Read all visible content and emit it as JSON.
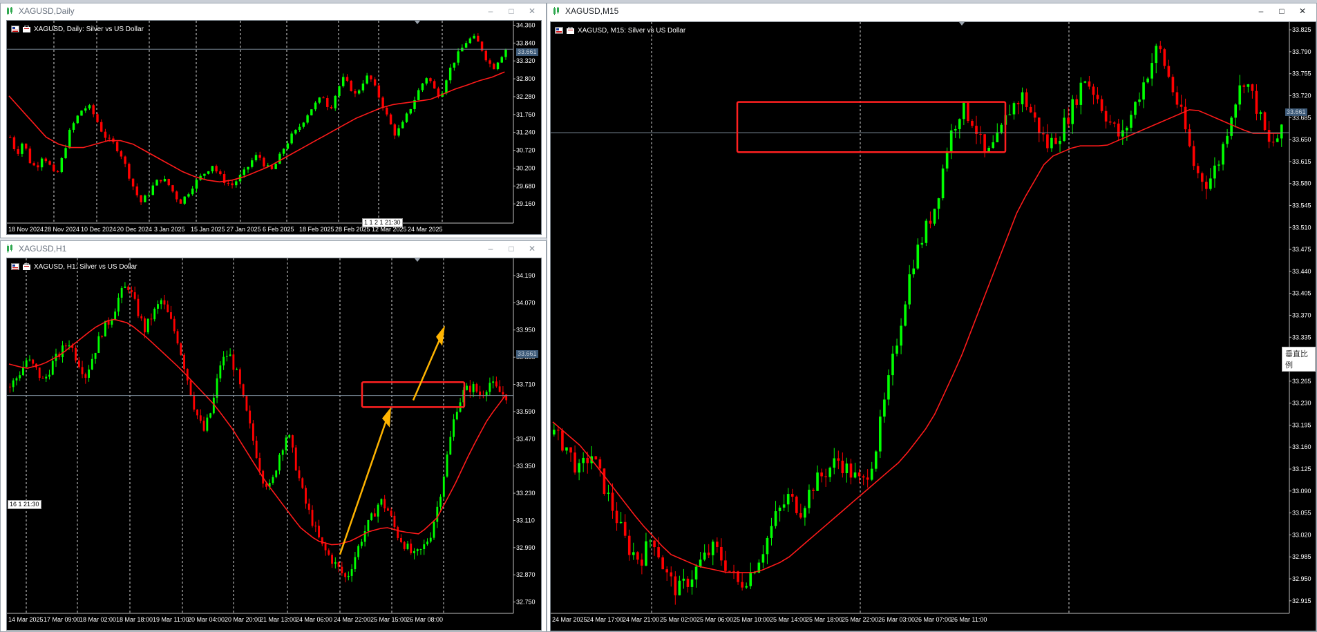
{
  "colors": {
    "bull": "#00ff00",
    "bear": "#ff0000",
    "ma": "#ff1a1a",
    "grid": "#ffffff",
    "bid_line": "#7c8b99",
    "box": "#ff2020",
    "arrow": "#ffb400",
    "axis_text": "#ffffff"
  },
  "windows": [
    {
      "id": "daily",
      "title": "XAGUSD,Daily",
      "chart_label": "XAGUSD, Daily:  Silver vs US Dollar",
      "price_tag": "33.661",
      "mini_tag": "1 1 2 1 21:30",
      "controls": {
        "minimize": "–",
        "maximize": "□",
        "close": "✕"
      }
    },
    {
      "id": "h1",
      "title": "XAGUSD,H1",
      "chart_label": "XAGUSD, H1:  Silver vs US Dollar",
      "price_tag": "33.661",
      "mini_tag": "16 1 21:30",
      "controls": {
        "minimize": "–",
        "maximize": "□",
        "close": "✕"
      }
    },
    {
      "id": "m15",
      "title": "XAGUSD,M15",
      "chart_label": "XAGUSD, M15:  Silver vs US Dollar",
      "price_tag": "33.661",
      "tooltip": "垂直比例",
      "controls": {
        "minimize": "–",
        "maximize": "□",
        "close": "✕"
      }
    }
  ],
  "chart_data": [
    {
      "type": "candlestick",
      "title": "XAGUSD, Daily:  Silver vs US Dollar",
      "x_tick_labels": [
        "18 Nov 2024",
        "28 Nov 2024",
        "10 Dec 2024",
        "20 Dec 2024",
        "3 Jan 2025",
        "15 Jan 2025",
        "27 Jan 2025",
        "6 Feb 2025",
        "18 Feb 2025",
        "28 Feb 2025",
        "12 Mar 2025",
        "24 Mar 2025"
      ],
      "y_tick_labels": [
        "34.360",
        "33.840",
        "33.320",
        "32.800",
        "32.280",
        "31.760",
        "31.240",
        "30.720",
        "30.200",
        "29.680",
        "29.160"
      ],
      "ylim": [
        28.6,
        34.45
      ],
      "current_price": 33.661,
      "close_path": [
        31.1,
        30.6,
        31.0,
        30.4,
        30.2,
        30.6,
        30.3,
        29.9,
        30.5,
        31.2,
        31.6,
        31.9,
        32.0,
        31.7,
        31.3,
        31.0,
        30.9,
        30.6,
        30.1,
        29.6,
        29.2,
        29.4,
        29.7,
        29.9,
        29.8,
        29.5,
        29.2,
        29.4,
        29.7,
        29.9,
        30.1,
        30.3,
        30.0,
        29.8,
        29.7,
        29.9,
        30.1,
        30.4,
        30.6,
        30.3,
        30.1,
        30.4,
        30.8,
        31.1,
        31.3,
        31.6,
        31.9,
        32.1,
        32.3,
        31.9,
        32.4,
        32.8,
        32.6,
        32.3,
        32.7,
        32.9,
        32.5,
        32.1,
        31.6,
        31.2,
        31.4,
        31.8,
        32.2,
        32.6,
        32.9,
        32.5,
        32.3,
        32.9,
        33.3,
        33.6,
        33.9,
        34.0,
        33.8,
        33.4,
        33.1,
        33.4,
        33.66
      ],
      "ma_path": [
        32.3,
        31.9,
        31.5,
        31.1,
        30.9,
        30.8,
        30.8,
        30.9,
        31.0,
        31.0,
        30.9,
        30.7,
        30.5,
        30.3,
        30.1,
        29.95,
        29.85,
        29.8,
        29.85,
        29.95,
        30.1,
        30.25,
        30.45,
        30.65,
        30.85,
        31.05,
        31.25,
        31.45,
        31.65,
        31.8,
        31.95,
        32.05,
        32.1,
        32.15,
        32.2,
        32.35,
        32.5,
        32.62,
        32.75,
        32.85,
        33.0
      ]
    },
    {
      "type": "candlestick",
      "title": "XAGUSD, H1:  Silver vs US Dollar",
      "x_tick_labels": [
        "14 Mar 2025",
        "17 Mar 09:00",
        "18 Mar 02:00",
        "18 Mar 18:00",
        "19 Mar 11:00",
        "20 Mar 04:00",
        "20 Mar 20:00",
        "21 Mar 13:00",
        "24 Mar 06:00",
        "24 Mar 22:00",
        "25 Mar 15:00",
        "26 Mar 08:00"
      ],
      "y_tick_labels": [
        "34.190",
        "34.070",
        "33.950",
        "33.830",
        "33.710",
        "33.590",
        "33.470",
        "33.350",
        "33.230",
        "33.110",
        "32.990",
        "32.870",
        "32.750"
      ],
      "ylim": [
        32.7,
        34.26
      ],
      "current_price": 33.661,
      "close_path": [
        33.7,
        33.75,
        33.82,
        33.78,
        33.72,
        33.8,
        33.85,
        33.9,
        33.82,
        33.75,
        33.85,
        33.95,
        34.0,
        34.1,
        34.15,
        34.05,
        33.95,
        34.02,
        34.08,
        34.0,
        33.9,
        33.75,
        33.6,
        33.5,
        33.6,
        33.8,
        33.85,
        33.75,
        33.6,
        33.45,
        33.3,
        33.25,
        33.4,
        33.5,
        33.35,
        33.2,
        33.1,
        33.0,
        32.95,
        32.9,
        32.85,
        32.95,
        33.05,
        33.12,
        33.2,
        33.15,
        33.05,
        33.0,
        32.95,
        32.98,
        33.05,
        33.2,
        33.4,
        33.6,
        33.68,
        33.7,
        33.66,
        33.72,
        33.68,
        33.66
      ],
      "ma_path": [
        33.8,
        33.78,
        33.8,
        33.84,
        33.9,
        33.96,
        34.0,
        33.98,
        33.92,
        33.85,
        33.78,
        33.7,
        33.62,
        33.52,
        33.4,
        33.28,
        33.18,
        33.08,
        33.02,
        33.0,
        33.02,
        33.06,
        33.08,
        33.06,
        33.05,
        33.12,
        33.26,
        33.42,
        33.56,
        33.66
      ],
      "annotations": {
        "range_box": [
          33.61,
          33.72
        ],
        "arrows": 2
      }
    },
    {
      "type": "candlestick",
      "title": "XAGUSD, M15:  Silver vs US Dollar",
      "x_tick_labels": [
        "24 Mar 2025",
        "24 Mar 17:00",
        "24 Mar 21:00",
        "25 Mar 02:00",
        "25 Mar 06:00",
        "25 Mar 10:00",
        "25 Mar 14:00",
        "25 Mar 18:00",
        "25 Mar 22:00",
        "26 Mar 03:00",
        "26 Mar 07:00",
        "26 Mar 11:00"
      ],
      "y_tick_labels": [
        "33.825",
        "33.790",
        "33.755",
        "33.720",
        "33.685",
        "33.650",
        "33.615",
        "33.580",
        "33.545",
        "33.510",
        "33.475",
        "33.440",
        "33.405",
        "33.370",
        "33.335",
        "33.300",
        "33.265",
        "33.230",
        "33.195",
        "33.160",
        "33.125",
        "33.090",
        "33.055",
        "33.020",
        "32.985",
        "32.950",
        "32.915"
      ],
      "ylim": [
        32.895,
        33.835
      ],
      "current_price": 33.661,
      "close_path": [
        33.18,
        33.16,
        33.12,
        33.15,
        33.1,
        33.05,
        33.0,
        32.98,
        33.02,
        32.96,
        32.93,
        32.95,
        32.98,
        33.0,
        32.97,
        32.94,
        32.96,
        33.0,
        33.05,
        33.08,
        33.06,
        33.1,
        33.12,
        33.14,
        33.12,
        33.1,
        33.15,
        33.25,
        33.35,
        33.45,
        33.5,
        33.55,
        33.65,
        33.7,
        33.68,
        33.62,
        33.65,
        33.7,
        33.72,
        33.68,
        33.64,
        33.66,
        33.7,
        33.75,
        33.72,
        33.68,
        33.65,
        33.7,
        33.75,
        33.8,
        33.74,
        33.68,
        33.6,
        33.58,
        33.62,
        33.7,
        33.75,
        33.7,
        33.64,
        33.66
      ],
      "ma_path": [
        33.2,
        33.16,
        33.1,
        33.04,
        32.99,
        32.97,
        32.96,
        32.96,
        32.98,
        33.02,
        33.06,
        33.1,
        33.14,
        33.2,
        33.3,
        33.42,
        33.54,
        33.62,
        33.64,
        33.64,
        33.66,
        33.68,
        33.7,
        33.68,
        33.66,
        33.66
      ],
      "annotations": {
        "range_box": [
          33.63,
          33.71
        ]
      }
    }
  ]
}
